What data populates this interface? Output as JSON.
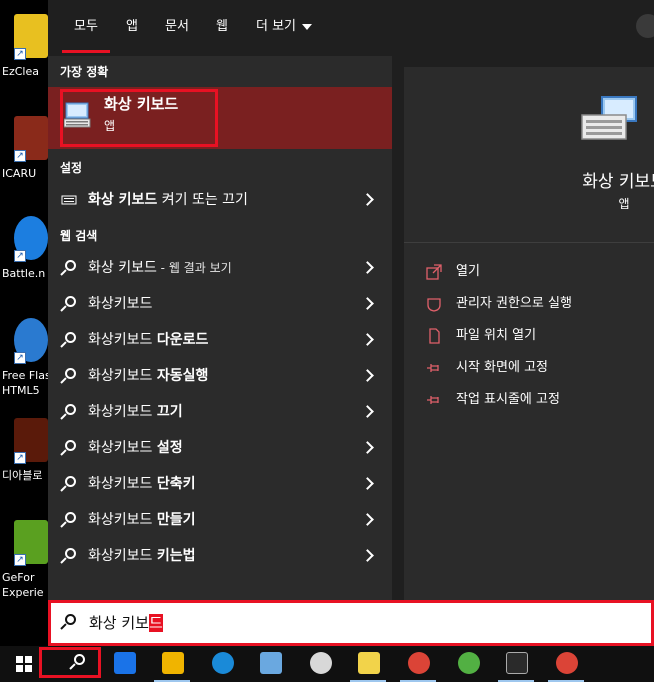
{
  "desktop": {
    "icons": [
      {
        "label": "EzClea",
        "color": "#e8c020"
      },
      {
        "label": "ICARU",
        "color": "#8a2a1a"
      },
      {
        "label": "Battle.n",
        "color": "#1c7ee0"
      },
      {
        "label": "Free Flas\nHTML5",
        "color": "#2a7ad0"
      },
      {
        "label": "디아블로",
        "color": "#5a1a0a"
      },
      {
        "label": "GeFor\nExperie",
        "color": "#5aa020"
      }
    ]
  },
  "tabs": [
    {
      "label": "모두"
    },
    {
      "label": "앱"
    },
    {
      "label": "문서"
    },
    {
      "label": "웹"
    },
    {
      "label": "더 보기"
    }
  ],
  "sections": {
    "best_match": "가장 정확",
    "settings": "설정",
    "web": "웹 검색"
  },
  "best_match": {
    "title": "화상 키보드",
    "subtitle": "앱"
  },
  "settings_row": {
    "bold": "화상 키보드",
    "rest": " 켜기 또는 끄기"
  },
  "web_rows": [
    {
      "bold": "",
      "text": "화상 키보드",
      "small": " - 웹 결과 보기"
    },
    {
      "bold": "",
      "text": "화상키보드",
      "small": ""
    },
    {
      "bold": "다운로드",
      "text": "화상키보드 ",
      "small": ""
    },
    {
      "bold": "자동실행",
      "text": "화상키보드 ",
      "small": ""
    },
    {
      "bold": "끄기",
      "text": "화상키보드 ",
      "small": ""
    },
    {
      "bold": "설정",
      "text": "화상키보드 ",
      "small": ""
    },
    {
      "bold": "단축키",
      "text": "화상키보드 ",
      "small": ""
    },
    {
      "bold": "만들기",
      "text": "화상키보드 ",
      "small": ""
    },
    {
      "bold": "키는법",
      "text": "화상키보드 ",
      "small": ""
    }
  ],
  "detail": {
    "title": "화상 키보드",
    "subtitle": "앱",
    "actions": [
      {
        "label": "열기",
        "icon": "open-icon"
      },
      {
        "label": "관리자 권한으로 실행",
        "icon": "shield-icon"
      },
      {
        "label": "파일 위치 열기",
        "icon": "file-location-icon"
      },
      {
        "label": "시작 화면에 고정",
        "icon": "pin-icon"
      },
      {
        "label": "작업 표시줄에 고정",
        "icon": "pin-icon"
      }
    ]
  },
  "search": {
    "typed": "화상 키보",
    "composing": "드"
  },
  "taskbar": {
    "apps": [
      {
        "name": "calendar-icon",
        "color": "#1a73e8"
      },
      {
        "name": "file-explorer-icon",
        "color": "#f0b400"
      },
      {
        "name": "internet-explorer-icon",
        "color": "#1a8ad8"
      },
      {
        "name": "app-icon",
        "color": "#6aa8e0"
      },
      {
        "name": "mascot-app-icon",
        "color": "#d8d8d8"
      },
      {
        "name": "kakao-app-icon",
        "color": "#f2d34a"
      },
      {
        "name": "chrome-icon",
        "color": "#db4437"
      },
      {
        "name": "xbox-icon",
        "color": "#52b043"
      },
      {
        "name": "terminal-icon",
        "color": "#2a2a2a"
      },
      {
        "name": "chrome-icon",
        "color": "#db4437"
      }
    ]
  },
  "accent": "#e81123"
}
